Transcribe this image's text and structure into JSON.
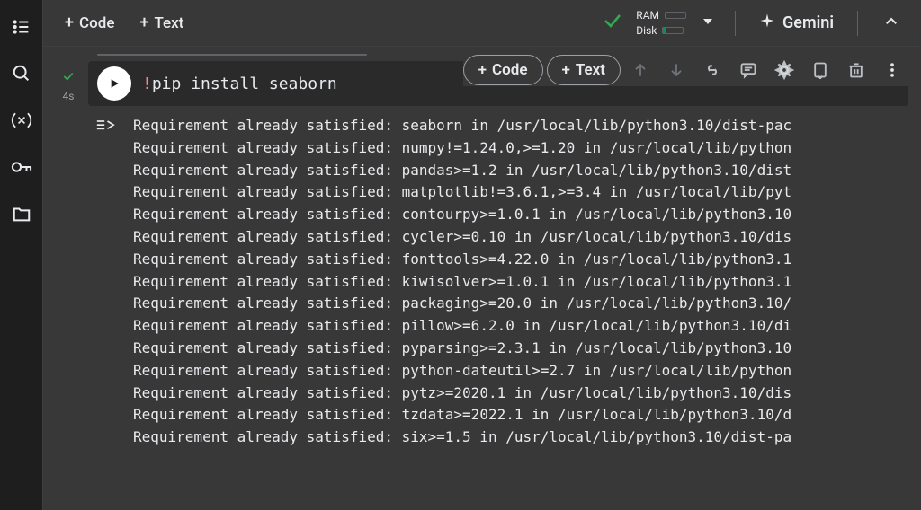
{
  "topbar": {
    "code_label": "Code",
    "text_label": "Text",
    "ram_label": "RAM",
    "disk_label": "Disk",
    "gemini_label": "Gemini"
  },
  "cell_toolbar": {
    "code_label": "Code",
    "text_label": "Text"
  },
  "cell": {
    "status": "ok",
    "duration": "4s",
    "code_prefix": "!",
    "code_body": "pip install seaborn"
  },
  "output_lines": [
    "Requirement already satisfied: seaborn in /usr/local/lib/python3.10/dist-pac",
    "Requirement already satisfied: numpy!=1.24.0,>=1.20 in /usr/local/lib/python",
    "Requirement already satisfied: pandas>=1.2 in /usr/local/lib/python3.10/dist",
    "Requirement already satisfied: matplotlib!=3.6.1,>=3.4 in /usr/local/lib/pyt",
    "Requirement already satisfied: contourpy>=1.0.1 in /usr/local/lib/python3.10",
    "Requirement already satisfied: cycler>=0.10 in /usr/local/lib/python3.10/dis",
    "Requirement already satisfied: fonttools>=4.22.0 in /usr/local/lib/python3.1",
    "Requirement already satisfied: kiwisolver>=1.0.1 in /usr/local/lib/python3.1",
    "Requirement already satisfied: packaging>=20.0 in /usr/local/lib/python3.10/",
    "Requirement already satisfied: pillow>=6.2.0 in /usr/local/lib/python3.10/di",
    "Requirement already satisfied: pyparsing>=2.3.1 in /usr/local/lib/python3.10",
    "Requirement already satisfied: python-dateutil>=2.7 in /usr/local/lib/python",
    "Requirement already satisfied: pytz>=2020.1 in /usr/local/lib/python3.10/dis",
    "Requirement already satisfied: tzdata>=2022.1 in /usr/local/lib/python3.10/d",
    "Requirement already satisfied: six>=1.5 in /usr/local/lib/python3.10/dist-pa"
  ]
}
